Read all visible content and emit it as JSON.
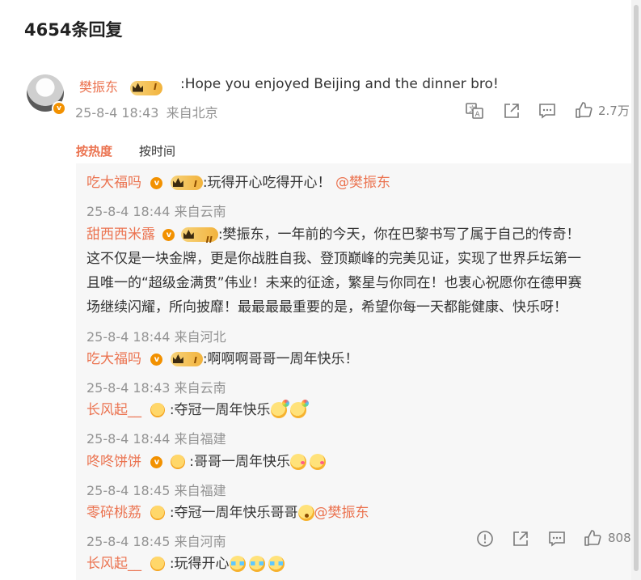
{
  "header": {
    "title": "4654条回复"
  },
  "main_comment": {
    "author": "樊振东",
    "level": "I",
    "text": ":Hope you enjoyed Beijing and the dinner bro!",
    "time": "25-8-4 18:43",
    "location": "来自北京",
    "likes": "2.7万"
  },
  "sort": {
    "hot": "按热度",
    "time": "按时间"
  },
  "replies": [
    {
      "author": "吃大福吗",
      "level": "I",
      "text": ":玩得开心吃得开心！",
      "mention": "@樊振东",
      "time": "25-8-4 18:44",
      "location": "来自云南"
    },
    {
      "author": "甜西西米露",
      "level": "II",
      "text_lines": [
        ":樊振东，一年前的今天，你在巴黎书写了属于自己的传奇！",
        "这不仅是一块金牌，更是你战胜自我、登顶巅峰的完美见证，实现了世界乒坛第一",
        "且唯一的“超级金满贯”伟业！未来的征途，繁星与你同在！也衷心祝愿你在德甲赛",
        "场继续闪耀，所向披靡！最最最最重要的是，希望你每一天都能健康、快乐呀！"
      ],
      "time": "25-8-4 18:44",
      "location": "来自河北"
    },
    {
      "author": "吃大福吗",
      "level": "I",
      "text": ":啊啊啊哥哥一周年快乐！",
      "time": "25-8-4 18:43",
      "location": "来自云南"
    },
    {
      "author": "长风起__",
      "text": ":夺冠一周年快乐",
      "time": "25-8-4 18:44",
      "location": "来自福建"
    },
    {
      "author": "咚咚饼饼",
      "text": ":哥哥一周年快乐",
      "time": "25-8-4 18:45",
      "location": "来自福建"
    },
    {
      "author": "零碎桃荔",
      "text": ":夺冠一周年快乐哥哥",
      "mention": "@樊振东",
      "time": "25-8-4 18:45",
      "location": "来自河南",
      "likes": "808"
    },
    {
      "author": "长风起__",
      "text": ":玩得开心"
    }
  ],
  "colors": {
    "accent": "#eb7350",
    "meta": "#939393",
    "thread_bg": "#f7f7f7"
  },
  "icons": [
    "translate-icon",
    "share-icon",
    "comment-icon",
    "like-icon",
    "report-icon"
  ]
}
